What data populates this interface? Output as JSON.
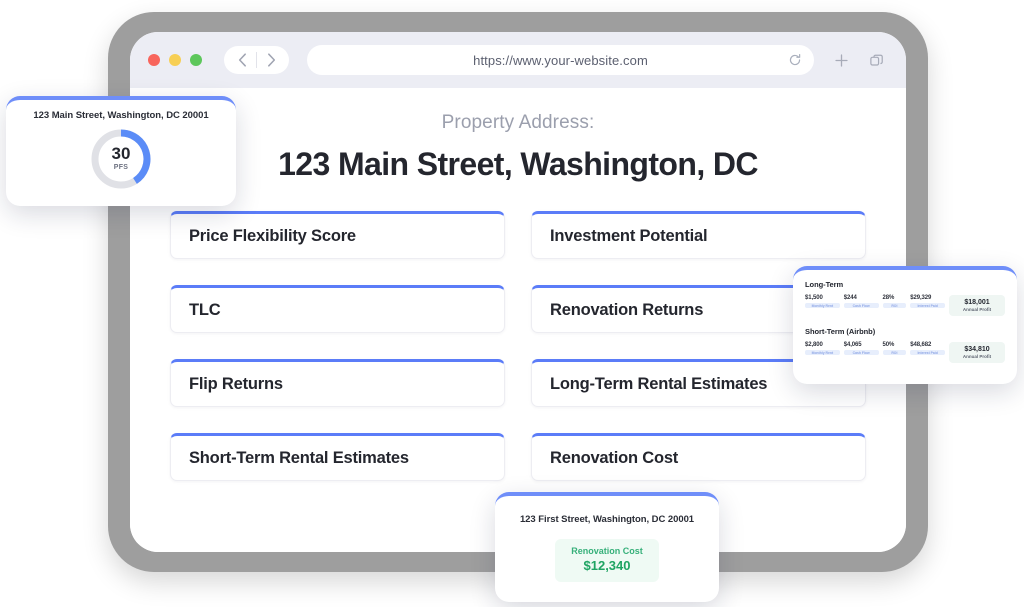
{
  "browser": {
    "url": "https://www.your-website.com",
    "back_icon": "chevron-left-icon",
    "forward_icon": "chevron-right-icon",
    "reload_icon": "reload-icon",
    "new_tab_icon": "plus-icon",
    "tabs_icon": "copy-tabs-icon",
    "traffic_lights": [
      "close",
      "minimize",
      "zoom"
    ]
  },
  "page": {
    "property_label": "Property Address:",
    "property_title": "123 Main Street, Washington, DC",
    "accordion": [
      {
        "label": "Price Flexibility Score"
      },
      {
        "label": "Investment Potential"
      },
      {
        "label": "TLC"
      },
      {
        "label": "Renovation Returns"
      },
      {
        "label": "Flip Returns"
      },
      {
        "label": "Long-Term Rental Estimates"
      },
      {
        "label": "Short-Term Rental Estimates"
      },
      {
        "label": "Renovation Cost"
      }
    ]
  },
  "pfs_card": {
    "address": "123 Main Street, Washington, DC 20001",
    "score": "30",
    "unit": "PFS",
    "arc_color": "#5b8cf7",
    "track_color": "#e0e1e6"
  },
  "rental_card": {
    "sections": [
      {
        "title": "Long-Term",
        "cells": [
          {
            "value": "$1,500",
            "label": "Monthly Rent"
          },
          {
            "value": "$244",
            "label": "Cash Flow"
          },
          {
            "value": "28%",
            "label": "ROI"
          },
          {
            "value": "$29,329",
            "label": "Interest Paid"
          }
        ],
        "total": {
          "value": "$18,001",
          "label": "Annual Profit"
        }
      },
      {
        "title": "Short-Term (Airbnb)",
        "cells": [
          {
            "value": "$2,800",
            "label": "Monthly Rent"
          },
          {
            "value": "$4,065",
            "label": "Cash Flow"
          },
          {
            "value": "50%",
            "label": "ROI"
          },
          {
            "value": "$48,682",
            "label": "Interest Paid"
          }
        ],
        "total": {
          "value": "$34,810",
          "label": "Annual Profit"
        }
      }
    ]
  },
  "reno_card": {
    "address": "123 First Street, Washington, DC 20001",
    "cost_label": "Renovation Cost",
    "cost_value": "$12,340",
    "accent_color": "#1fa463"
  }
}
